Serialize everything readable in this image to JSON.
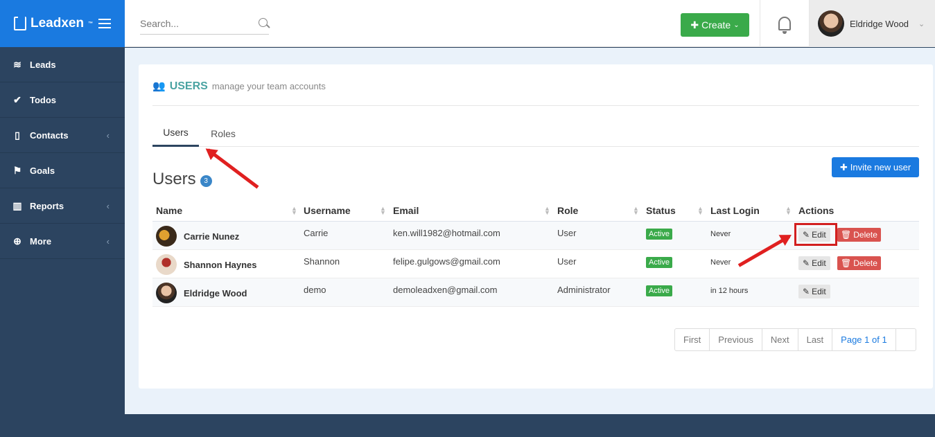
{
  "brand": {
    "name": "Leadxen",
    "tm": "™"
  },
  "search": {
    "placeholder": "Search..."
  },
  "header": {
    "create_label": "Create",
    "user_name": "Eldridge Wood"
  },
  "sidebar": {
    "items": [
      {
        "label": "Leads",
        "icon": "layers-icon"
      },
      {
        "label": "Todos",
        "icon": "check-circle-icon"
      },
      {
        "label": "Contacts",
        "icon": "address-book-icon",
        "caret": true
      },
      {
        "label": "Goals",
        "icon": "flag-icon"
      },
      {
        "label": "Reports",
        "icon": "bar-chart-icon",
        "caret": true
      },
      {
        "label": "More",
        "icon": "plus-circle-icon",
        "caret": true
      }
    ]
  },
  "page": {
    "title": "USERS",
    "subtitle": "manage your team accounts",
    "tabs": [
      {
        "label": "Users",
        "active": true
      },
      {
        "label": "Roles",
        "active": false
      }
    ],
    "section_title": "Users",
    "count": "3",
    "invite_label": "Invite new user"
  },
  "table": {
    "columns": [
      "Name",
      "Username",
      "Email",
      "Role",
      "Status",
      "Last Login",
      "Actions"
    ],
    "rows": [
      {
        "name": "Carrie Nunez",
        "username": "Carrie",
        "email": "ken.will1982@hotmail.com",
        "role": "User",
        "status": "Active",
        "last_login": "Never",
        "edit": "Edit",
        "delete": "Delete"
      },
      {
        "name": "Shannon Haynes",
        "username": "Shannon",
        "email": "felipe.gulgows@gmail.com",
        "role": "User",
        "status": "Active",
        "last_login": "Never",
        "edit": "Edit",
        "delete": "Delete"
      },
      {
        "name": "Eldridge Wood",
        "username": "demo",
        "email": "demoleadxen@gmail.com",
        "role": "Administrator",
        "status": "Active",
        "last_login": "in 12 hours",
        "edit": "Edit",
        "delete": null
      }
    ]
  },
  "pagination": {
    "first": "First",
    "previous": "Previous",
    "next": "Next",
    "last": "Last",
    "current": "Page 1 of 1"
  },
  "colors": {
    "brand_blue": "#1a7ae0",
    "sidebar": "#2c4460",
    "accent_teal": "#4aa3a2",
    "success": "#3aaa4a",
    "danger": "#d9534f",
    "annotation_red": "#e02020"
  }
}
